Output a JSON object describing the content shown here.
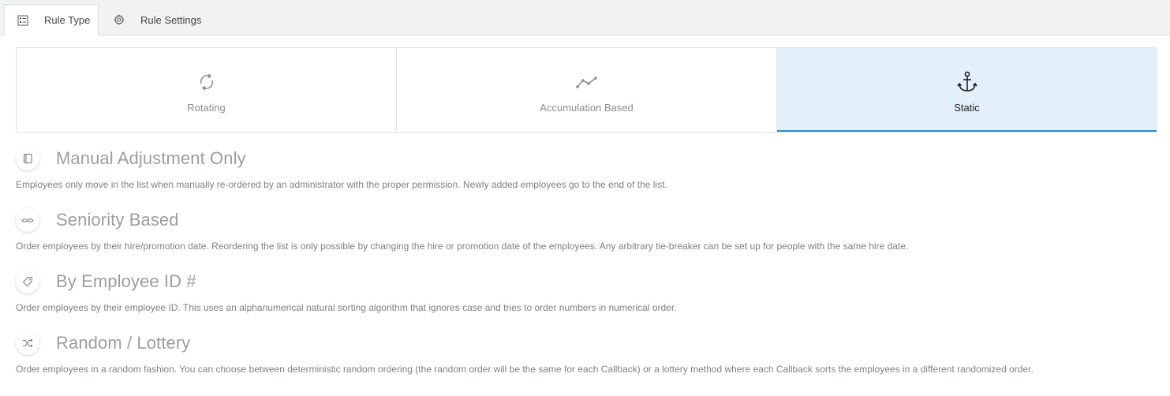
{
  "tabs": [
    {
      "label": "Rule Type",
      "icon": "list-icon",
      "active": true
    },
    {
      "label": "Rule Settings",
      "icon": "gear-icon",
      "active": false
    }
  ],
  "rule_types": [
    {
      "label": "Rotating",
      "icon": "rotate-icon",
      "selected": false
    },
    {
      "label": "Accumulation Based",
      "icon": "line-chart-icon",
      "selected": false
    },
    {
      "label": "Static",
      "icon": "anchor-icon",
      "selected": true
    }
  ],
  "options": [
    {
      "title": "Manual Adjustment Only",
      "icon": "notebook-icon",
      "description": "Employees only move in the list when manually re-ordered by an administrator with the proper permission. Newly added employees go to the end of the list."
    },
    {
      "title": "Seniority Based",
      "icon": "mustache-icon",
      "description": "Order employees by their hire/promotion date. Reordering the list is only possible by changing the hire or promotion date of the employees. Any arbitrary tie-breaker can be set up for people with the same hire date."
    },
    {
      "title": "By Employee ID #",
      "icon": "tag-icon",
      "description": "Order employees by their employee ID. This uses an alphanumerical natural sorting algorithm that ignores case and tries to order numbers in numerical order."
    },
    {
      "title": "Random / Lottery",
      "icon": "shuffle-icon",
      "description": "Order employees in a random fashion. You can choose between deterministic random ordering (the random order will be the same for each Callback) or a lottery method where each Callback sorts the employees in a different randomized order."
    }
  ],
  "colors": {
    "selected_bg": "#e3f0fb",
    "selected_border": "#2a8fd6",
    "tabbar_bg": "#f0f2f3"
  }
}
